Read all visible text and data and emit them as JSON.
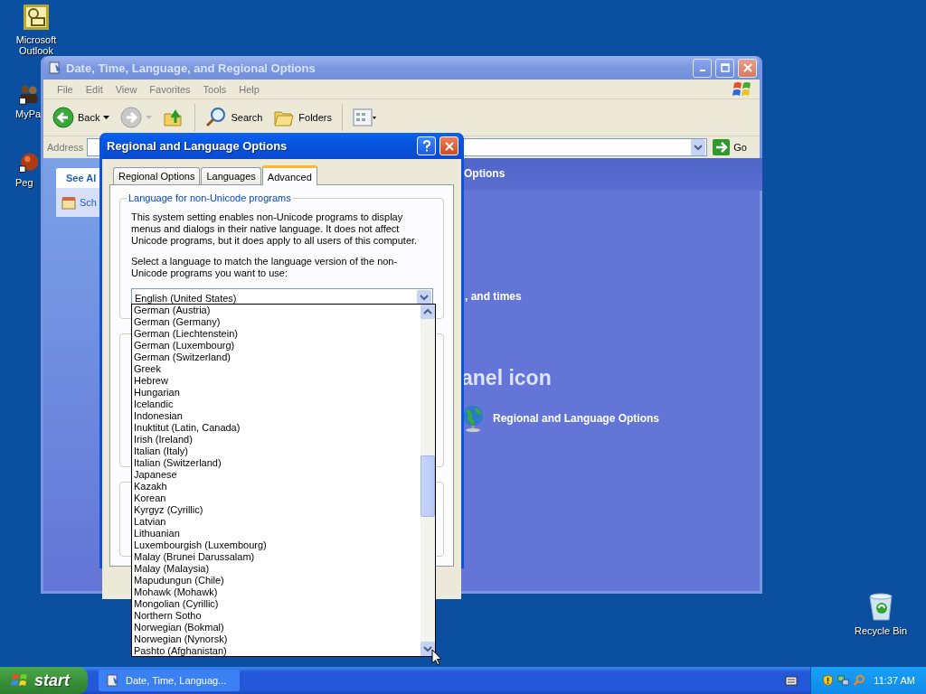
{
  "desktop_icons": [
    {
      "label": "Microsoft Outlook",
      "kind": "mail"
    },
    {
      "label": "MyPa",
      "kind": "people"
    },
    {
      "label": "Peg",
      "kind": "ball"
    },
    {
      "label": "Recycle Bin",
      "kind": "bin"
    }
  ],
  "explorer": {
    "title": "Date, Time, Language, and Regional Options",
    "active": false,
    "menu": [
      "File",
      "Edit",
      "View",
      "Favorites",
      "Tools",
      "Help"
    ],
    "toolbar": [
      {
        "kind": "back",
        "label": "Back",
        "disabled": false
      },
      {
        "kind": "forward",
        "disabled": true
      },
      {
        "kind": "up"
      },
      {
        "kind": "search",
        "label": "Search"
      },
      {
        "kind": "folders",
        "label": "Folders"
      },
      {
        "kind": "views"
      }
    ],
    "address": {
      "label": "Address",
      "go": "Go"
    },
    "see_also": {
      "title": "See Al",
      "items": [
        "Sch"
      ]
    },
    "content": {
      "heading": "Options",
      "text": ", and times",
      "subheading": "anel icon",
      "links": [
        "Regional and Language Options"
      ]
    }
  },
  "dialog": {
    "title": "Regional and Language Options",
    "active": true,
    "tabs": [
      {
        "label": "Regional Options",
        "selected": false
      },
      {
        "label": "Languages",
        "selected": false
      },
      {
        "label": "Advanced",
        "selected": true
      }
    ],
    "group": {
      "title": "Language for non-Unicode programs",
      "paragraphs": [
        "This system setting enables non-Unicode programs to display menus and dialogs in their native language. It does not affect Unicode programs, but it does apply to all users of this computer.",
        "Select a language to match the language version of the non-Unicode programs you want to use:"
      ],
      "combo": {
        "value": "English (United States)",
        "expanded": true
      },
      "options": [
        "German (Austria)",
        "German (Germany)",
        "German (Liechtenstein)",
        "German (Luxembourg)",
        "German (Switzerland)",
        "Greek",
        "Hebrew",
        "Hungarian",
        "Icelandic",
        "Indonesian",
        "Inuktitut (Latin, Canada)",
        "Irish (Ireland)",
        "Italian (Italy)",
        "Italian (Switzerland)",
        "Japanese",
        "Kazakh",
        "Korean",
        "Kyrgyz (Cyrillic)",
        "Latvian",
        "Lithuanian",
        "Luxembourgish (Luxembourg)",
        "Malay (Brunei Darussalam)",
        "Malay (Malaysia)",
        "Mapudungun (Chile)",
        "Mohawk (Mohawk)",
        "Mongolian (Cyrillic)",
        "Northern Sotho",
        "Norwegian (Bokmal)",
        "Norwegian (Nynorsk)",
        "Pashto (Afghanistan)"
      ]
    }
  },
  "taskbar": {
    "start": "start",
    "tasks": [
      {
        "label": "Date, Time, Languag..."
      }
    ],
    "clock": "11:37 AM"
  }
}
